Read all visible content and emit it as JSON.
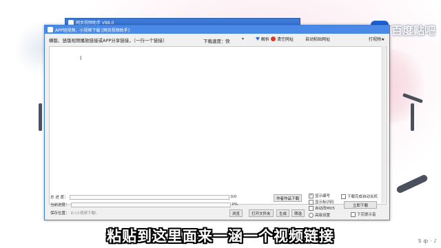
{
  "watermark": {
    "logo": "贴",
    "text": "百度贴吧"
  },
  "back_window": {
    "title": "网页视频助手 V88.0"
  },
  "window": {
    "title": "APP短视频、小视频下载 [网页视频助手]",
    "url_hint": "横版、竖版视频播放链接或APP分享链接，（一行一个链接）",
    "speed_label": "下载速度：",
    "speed_value": "快",
    "dropdown_icon": "chevron-down",
    "parse_label": "解析",
    "clear_label": "清空网址",
    "auto_label": "自动粘贴网址",
    "more_label": "打视频★",
    "cursor_glyph": "I"
  },
  "bottom": {
    "total_label": "总 进 度：",
    "total_value": "0/0",
    "current_label": "当前进度：",
    "current_value": "0%",
    "save_label": "保存位置：",
    "save_path": "D:\\小视频下载\\",
    "btn_author": "作者作品下载",
    "btn_browse": "浏览",
    "btn_open": "打开文件夹",
    "btn_generate": "生成",
    "btn_select": "筛选",
    "chk_number": "显示编号",
    "chk_watermark": "显示标识码",
    "chk_autoprefix": "自动改MD5",
    "radio_advanced": "高级设置",
    "chk_shutdown": "下载完成自动关机",
    "btn_download": "立即下载",
    "chk_prompt": "下完提示音"
  },
  "subtitle": "粘贴到这里面来一涵一个视频链接",
  "tray": {
    "items": [
      "S",
      "中",
      "·",
      "♪"
    ]
  }
}
